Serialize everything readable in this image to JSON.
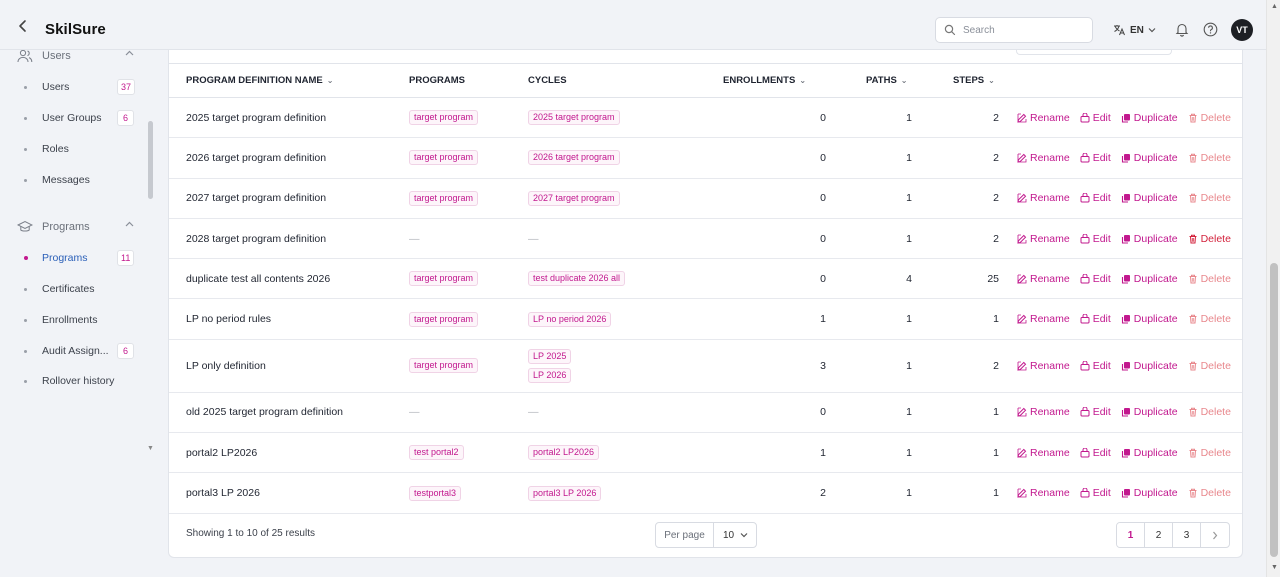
{
  "app": {
    "title": "SkilSure"
  },
  "header": {
    "search_placeholder": "Search",
    "language": "EN",
    "avatar_initials": "VT"
  },
  "sidebar": {
    "users_section": "Users",
    "users_items": [
      {
        "label": "Users",
        "count": "37"
      },
      {
        "label": "User Groups",
        "count": "6"
      },
      {
        "label": "Roles",
        "count": ""
      },
      {
        "label": "Messages",
        "count": ""
      }
    ],
    "programs_section": "Programs",
    "programs_items": [
      {
        "label": "Programs",
        "count": "11",
        "active": true
      },
      {
        "label": "Certificates",
        "count": ""
      },
      {
        "label": "Enrollments",
        "count": ""
      },
      {
        "label": "Audit Assign...",
        "count": "6"
      },
      {
        "label": "Rollover history",
        "count": ""
      }
    ]
  },
  "table": {
    "headers": {
      "name": "PROGRAM DEFINITION NAME",
      "programs": "PROGRAMS",
      "cycles": "CYCLES",
      "enrollments": "ENROLLMENTS",
      "paths": "PATHS",
      "steps": "STEPS"
    },
    "actions": {
      "rename": "Rename",
      "edit": "Edit",
      "duplicate": "Duplicate",
      "delete": "Delete"
    },
    "rows": [
      {
        "name": "2025 target program definition",
        "programs": [
          "target program"
        ],
        "cycles": [
          "2025 target program"
        ],
        "enrollments": "0",
        "paths": "1",
        "steps": "2"
      },
      {
        "name": "2026 target program definition",
        "programs": [
          "target program"
        ],
        "cycles": [
          "2026 target program"
        ],
        "enrollments": "0",
        "paths": "1",
        "steps": "2"
      },
      {
        "name": "2027 target program definition",
        "programs": [
          "target program"
        ],
        "cycles": [
          "2027 target program"
        ],
        "enrollments": "0",
        "paths": "1",
        "steps": "2"
      },
      {
        "name": "2028 target program definition",
        "programs": [],
        "cycles": [],
        "enrollments": "0",
        "paths": "1",
        "steps": "2",
        "delete_active": true
      },
      {
        "name": "duplicate test all contents 2026",
        "programs": [
          "target program"
        ],
        "cycles": [
          "test duplicate 2026 all"
        ],
        "enrollments": "0",
        "paths": "4",
        "steps": "25"
      },
      {
        "name": "LP no period rules",
        "programs": [
          "target program"
        ],
        "cycles": [
          "LP no period 2026"
        ],
        "enrollments": "1",
        "paths": "1",
        "steps": "1"
      },
      {
        "name": "LP only definition",
        "programs": [
          "target program"
        ],
        "cycles": [
          "LP 2025",
          "LP 2026"
        ],
        "enrollments": "3",
        "paths": "1",
        "steps": "2"
      },
      {
        "name": "old 2025 target program definition",
        "programs": [],
        "cycles": [],
        "enrollments": "0",
        "paths": "1",
        "steps": "1"
      },
      {
        "name": "portal2 LP2026",
        "programs": [
          "test portal2"
        ],
        "cycles": [
          "portal2 LP2026"
        ],
        "enrollments": "1",
        "paths": "1",
        "steps": "1"
      },
      {
        "name": "portal3 LP 2026",
        "programs": [
          "testportal3"
        ],
        "cycles": [
          "portal3 LP 2026"
        ],
        "enrollments": "2",
        "paths": "1",
        "steps": "1"
      }
    ],
    "empty_marker": "—"
  },
  "footer": {
    "showing": "Showing 1 to 10 of 25 results",
    "per_page_label": "Per page",
    "per_page_value": "10",
    "pages": [
      "1",
      "2",
      "3"
    ],
    "current_page": "1"
  },
  "colors": {
    "accent": "#c2188e",
    "active_nav": "#2a5fb8",
    "delete": "#e8878c",
    "delete_strong": "#d3223c"
  }
}
